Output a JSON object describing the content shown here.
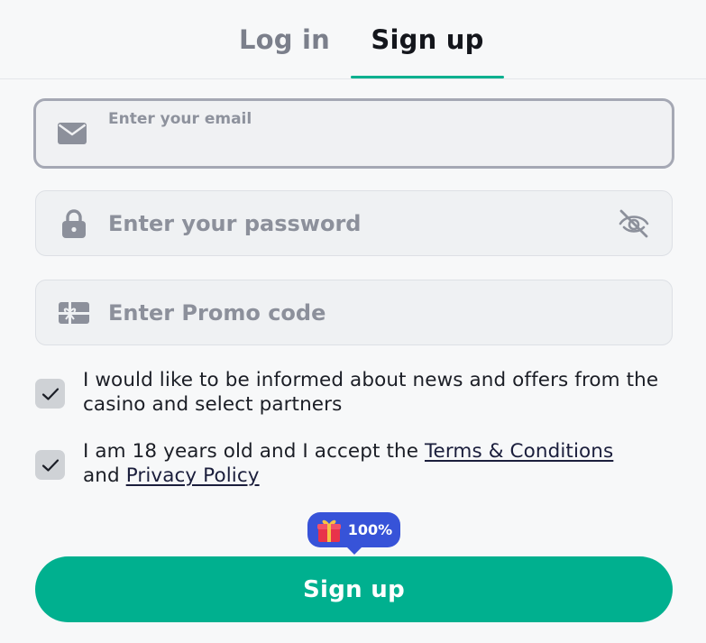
{
  "tabs": {
    "login_label": "Log in",
    "signup_label": "Sign up",
    "active": "signup"
  },
  "form": {
    "email": {
      "label": "Enter your email",
      "value": "",
      "icon": "envelope-icon"
    },
    "password": {
      "placeholder": "Enter your password",
      "value": "",
      "icon": "lock-icon",
      "toggle_icon": "eye-off-icon"
    },
    "promo": {
      "placeholder": "Enter Promo code",
      "value": "",
      "icon": "gift-card-icon"
    },
    "news_consent": {
      "checked": true,
      "text": "I would like to be informed about news and offers from the casino and select partners"
    },
    "terms_consent": {
      "checked": true,
      "text_before": "I am 18 years old and I accept the ",
      "terms_link": "Terms & Conditions",
      "text_and": "and ",
      "privacy_link": "Privacy Policy"
    },
    "bonus_badge": {
      "text": "100%",
      "icon": "gift-icon"
    },
    "submit_label": "Sign up"
  },
  "colors": {
    "accent": "#00b08f",
    "badge": "#3753d8",
    "background": "#f7f8f9",
    "field_bg": "#eff1f3"
  }
}
